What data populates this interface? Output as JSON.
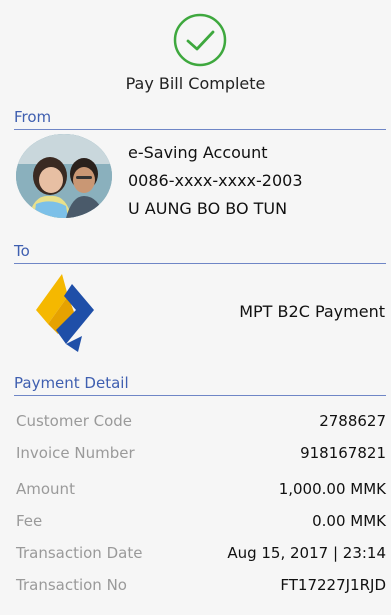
{
  "header": {
    "status_icon": "check-circle-icon",
    "title": "Pay Bill Complete",
    "accent_color": "#3ea83e"
  },
  "from": {
    "section_label": "From",
    "account_type": "e-Saving Account",
    "account_number": "0086-xxxx-xxxx-2003",
    "account_holder": "U AUNG BO BO TUN"
  },
  "to": {
    "section_label": "To",
    "biller_name": "MPT B2C Payment",
    "logo_colors": [
      "#f5b800",
      "#1f4fa8"
    ]
  },
  "payment_detail": {
    "section_label": "Payment Detail",
    "rows": [
      {
        "label": "Customer Code",
        "value": "2788627"
      },
      {
        "label": "Invoice Number",
        "value": "918167821"
      },
      {
        "label": "Amount",
        "value": "1,000.00 MMK"
      },
      {
        "label": "Fee",
        "value": "0.00 MMK"
      },
      {
        "label": "Transaction Date",
        "value": "Aug 15, 2017 | 23:14"
      },
      {
        "label": "Transaction No",
        "value": "FT17227J1RJD"
      }
    ]
  },
  "colors": {
    "section_heading": "#3f5fb0",
    "divider": "#6f86c6",
    "label_gray": "#9a9a9a",
    "background": "#f6f6f6"
  }
}
